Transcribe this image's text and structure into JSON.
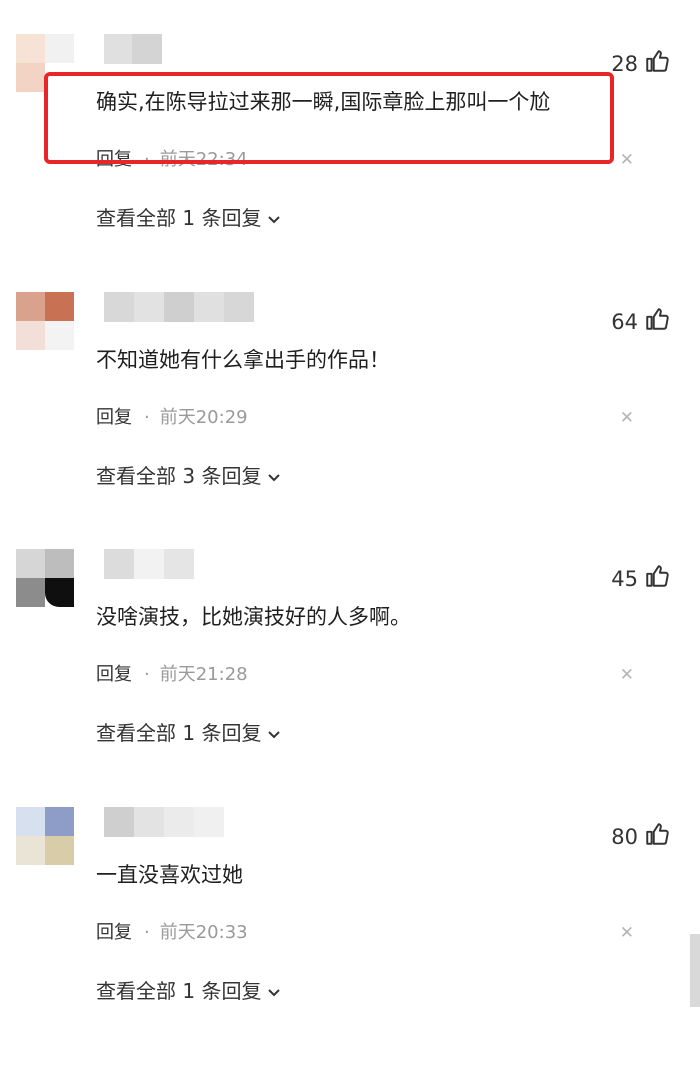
{
  "comments": [
    {
      "text": "确实,在陈导拉过来那一瞬,国际章脸上那叫一个尬",
      "likes": "28",
      "reply_label": "回复",
      "separator": "·",
      "time": "前天22:34",
      "view_all": "查看全部 1 条回复",
      "avatar_colors": [
        "#f6e3d5",
        "#f1f1f1",
        "#f3d3c3",
        "#ffffff"
      ],
      "name_colors": [
        "#e0e0e0",
        "#d4d4d4"
      ]
    },
    {
      "text": "不知道她有什么拿出手的作品！",
      "likes": "64",
      "reply_label": "回复",
      "separator": "·",
      "time": "前天20:29",
      "view_all": "查看全部 3 条回复",
      "avatar_colors": [
        "#d9a28c",
        "#c87253",
        "#f2dfd7",
        "#f3f3f3"
      ],
      "name_colors": [
        "#d8d8d8",
        "#e2e2e2",
        "#cfcfcf",
        "#e0e0e0",
        "#d7d7d7"
      ]
    },
    {
      "text": "没啥演技，比她演技好的人多啊。",
      "likes": "45",
      "reply_label": "回复",
      "separator": "·",
      "time": "前天21:28",
      "view_all": "查看全部 1 条回复",
      "avatar_colors": [
        "#d6d6d6",
        "#bdbdbd",
        "#8c8c8c",
        "#0f0f0f"
      ],
      "name_colors": [
        "#dcdcdc",
        "#f2f2f2",
        "#e5e5e5"
      ]
    },
    {
      "text": "一直没喜欢过她",
      "likes": "80",
      "reply_label": "回复",
      "separator": "·",
      "time": "前天20:33",
      "view_all": "查看全部 1 条回复",
      "avatar_colors": [
        "#d7e0ee",
        "#8e9dc7",
        "#e9e4d6",
        "#d9cda9"
      ],
      "name_colors": [
        "#cfcfcf",
        "#e3e3e3",
        "#ebebeb",
        "#f0f0f0"
      ]
    }
  ],
  "highlight_color": "#e8262a"
}
